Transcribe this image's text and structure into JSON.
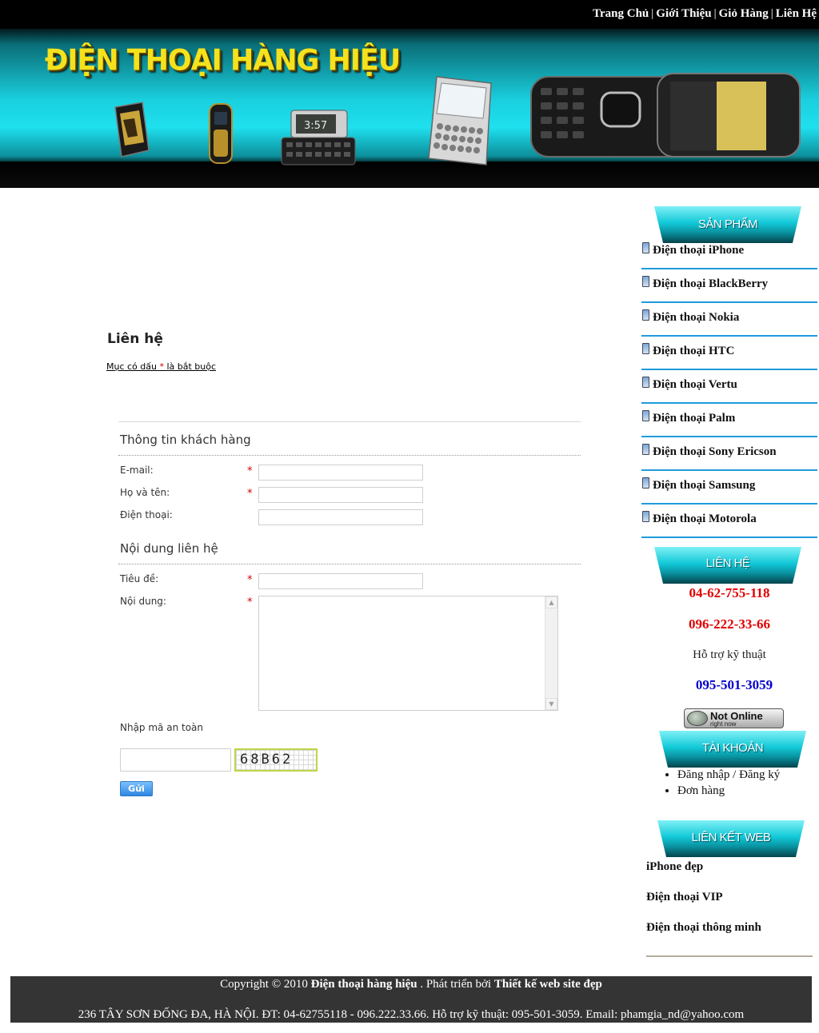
{
  "topnav": {
    "items": [
      "Trang Chủ",
      "Giới Thiệu",
      "Giỏ Hàng",
      "Liên Hệ"
    ],
    "separator": "|"
  },
  "banner": {
    "title": "ĐIỆN THOẠI HÀNG HIỆU",
    "phone_screen_text": "3:57"
  },
  "main": {
    "page_title": "Liên hệ",
    "required_note_before": "Mục có dấu ",
    "required_star": "*",
    "required_note_after": " là bắt buộc",
    "customer_section_title": "Thông tin khách hàng",
    "content_section_title": "Nội dung liên hệ",
    "fields": {
      "email_label": "E-mail:",
      "name_label": "Họ và tên:",
      "phone_label": "Điện thoại:",
      "subject_label": "Tiêu đề:",
      "message_label": "Nội dung:"
    },
    "email_value": "",
    "name_value": "",
    "phone_value": "",
    "subject_value": "",
    "message_value": "",
    "captcha_label": "Nhập mã an toàn",
    "captcha_value": "",
    "captcha_code": "68B62",
    "send_label": "Gửi"
  },
  "sidebar": {
    "products_header": "SẢN PHẨM",
    "products": [
      "Điện thoại iPhone",
      "Điện thoại BlackBerry",
      "Điện thoại Nokia",
      "Điện thoại HTC",
      "Điện thoại Vertu",
      "Điện thoại Palm",
      "Điện thoại Sony Ericson",
      "Điện thoại Samsung",
      "Điện thoại Motorola"
    ],
    "contact_header": "LIÊN HỆ",
    "hotline_1": "04-62-755-118",
    "hotline_2": "096-222-33-66",
    "support_label": "Hỗ trợ kỹ thuật",
    "support_phone": "095-501-3059",
    "status_main": "Not Online",
    "status_sub": "right now",
    "account_header": "TÀI KHOẢN",
    "account_items": [
      "Đăng nhập / Đăng ký",
      "Đơn hàng"
    ],
    "weblinks_header": "LIÊN KẾT WEB",
    "weblinks": [
      "iPhone đẹp",
      "Điện thoại VIP",
      "Điện thoại thông minh"
    ]
  },
  "footer": {
    "copyright_prefix": "Copyright © 2010 ",
    "site_name": "Điện thoại hàng hiệu",
    "developed_by": " . Phát triển bởi ",
    "developer": "Thiết kế web site đẹp",
    "address_line": "236 TÂY SƠN ĐỐNG ĐA, HÀ NỘI. ĐT: 04-62755118 - 096.222.33.66. Hỗ trợ kỹ thuật: 095-501-3059. Email: phamgia_nd@yahoo.com"
  },
  "colors": {
    "required": "#d00000",
    "hotline": "#e00000",
    "support": "#0000d0",
    "accent_cyan": "#12c9d8",
    "divider_blue": "#1f9bdc",
    "footer_bg": "#343434",
    "banner_title": "#f5e21c"
  }
}
